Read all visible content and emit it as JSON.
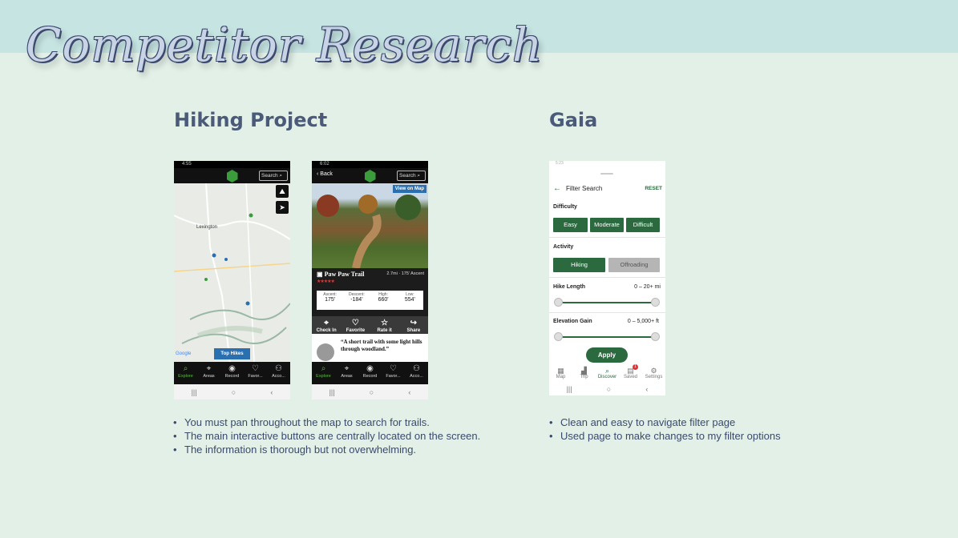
{
  "slide": {
    "title": "Competitor Research",
    "left_heading": "Hiking Project",
    "right_heading": "Gaia"
  },
  "hp_map": {
    "status_time": "4:55",
    "search": "Search",
    "city_label": "Lexington",
    "top_hikes": "Top Hikes",
    "google": "Google",
    "tabs": [
      "Explore",
      "Areas",
      "Record",
      "Favor...",
      "Acco..."
    ]
  },
  "hp_trail": {
    "status_time": "6:02",
    "back": "Back",
    "search": "Search",
    "view_on_map": "View on Map",
    "trail_name": "Paw Paw Trail",
    "trail_meta": "2.7mi · 175' Ascent",
    "stats": [
      {
        "label": "Ascent:",
        "value": "175'"
      },
      {
        "label": "Descent:",
        "value": "-184'"
      },
      {
        "label": "High:",
        "value": "660'"
      },
      {
        "label": "Low:",
        "value": "554'"
      }
    ],
    "actions": [
      "Check In",
      "Favorite",
      "Rate it",
      "Share"
    ],
    "quote": "“A short trail with some light hills through woodland.”",
    "tabs": [
      "Explore",
      "Areas",
      "Record",
      "Favor...",
      "Acco..."
    ]
  },
  "gaia": {
    "status_time": "5:23",
    "header": "Filter Search",
    "reset": "RESET",
    "difficulty_label": "Difficulty",
    "difficulty_options": [
      "Easy",
      "Moderate",
      "Difficult"
    ],
    "activity_label": "Activity",
    "activity_options": [
      "Hiking",
      "Offroading"
    ],
    "hike_length_label": "Hike Length",
    "hike_length_value": "0 – 20+ mi",
    "elevation_label": "Elevation Gain",
    "elevation_value": "0 – 5,000+ ft",
    "apply": "Apply",
    "tabs": [
      "Map",
      "Trip",
      "Discover",
      "Saved",
      "Settings"
    ],
    "saved_badge": "1",
    "brand_green": "#2a6a3e"
  },
  "bullets_left": [
    "You must pan throughout the map to search for trails.",
    "The main interactive buttons are centrally located on the screen.",
    "The information is thorough but not overwhelming."
  ],
  "bullets_right": [
    "Clean and easy to navigate filter page",
    "Used page to make changes to my filter options"
  ]
}
